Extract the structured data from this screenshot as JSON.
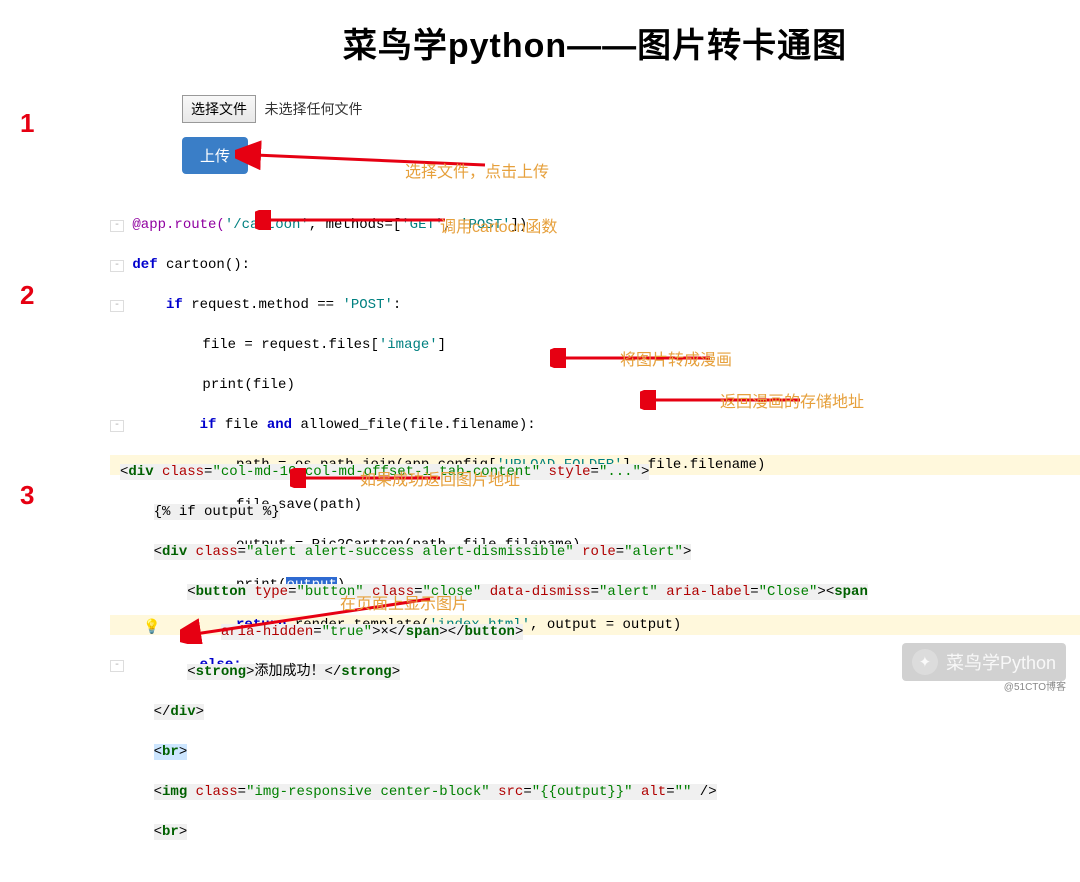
{
  "steps": {
    "s1": "1",
    "s2": "2",
    "s3": "3"
  },
  "title": "菜鸟学python——图片转卡通图",
  "form": {
    "choose_btn": "选择文件",
    "no_file": "未选择任何文件",
    "upload_btn": "上传"
  },
  "anno": {
    "choose_upload": "选择文件，点击上传",
    "call_cartoon": "调用cartoon函数",
    "to_comic": "将图片转成漫画",
    "return_addr": "返回漫画的存储地址",
    "if_output": "如果成功返回图片地址",
    "show_img": "在页面上显示图片"
  },
  "code1": {
    "l1a": "@app.route(",
    "l1b": "'/cartoon'",
    "l1c": ", methods=[",
    "l1d": "'GET'",
    "l1e": ", ",
    "l1f": "'POST'",
    "l1g": "])",
    "l2a": "def",
    "l2b": " cartoon():",
    "l3a": "    if",
    "l3b": " request.method == ",
    "l3c": "'POST'",
    "l3d": ":",
    "l4a": "        file = request.files[",
    "l4b": "'image'",
    "l4c": "]",
    "l5": "        print(file)",
    "l6a": "        if",
    "l6b": " file ",
    "l6c": "and",
    "l6d": " allowed_file(file.filename):",
    "l7a": "            path = os.path.join(app.config[",
    "l7b": "'UPLOAD_FOLDER'",
    "l7c": "], file.filename)",
    "l8": "            file.save(path)",
    "l9": "            output = Pic2Cartton(path, file.filename)",
    "l10a": "            print(",
    "l10b": "output",
    "l10c": ")",
    "l11a": "            return",
    "l11b": " render_template(",
    "l11c": "'index.html'",
    "l11d": ", output = output)",
    "l12": "        else:"
  },
  "code2": {
    "l1": "<div class=\"col-md-10 col-md-offset-1 tab-content\" style=\"...\">",
    "l2": "    {% if output %}",
    "l3": "    <div class=\"alert alert-success alert-dismissible\" role=\"alert\">",
    "l4": "        <button type=\"button\" class=\"close\" data-dismiss=\"alert\" aria-label=\"Close\"><span",
    "l5": "            aria-hidden=\"true\">×</span></button>",
    "l6": "        <strong>添加成功！</strong>",
    "l7": "    </div>",
    "l8": "    <br>",
    "l9": "    <img class=\"img-responsive center-block\" src=\"{{output}}\" alt=\"\" />",
    "l10": "    <br>"
  },
  "watermark": "菜鸟学Python",
  "credit": "@51CTO博客"
}
